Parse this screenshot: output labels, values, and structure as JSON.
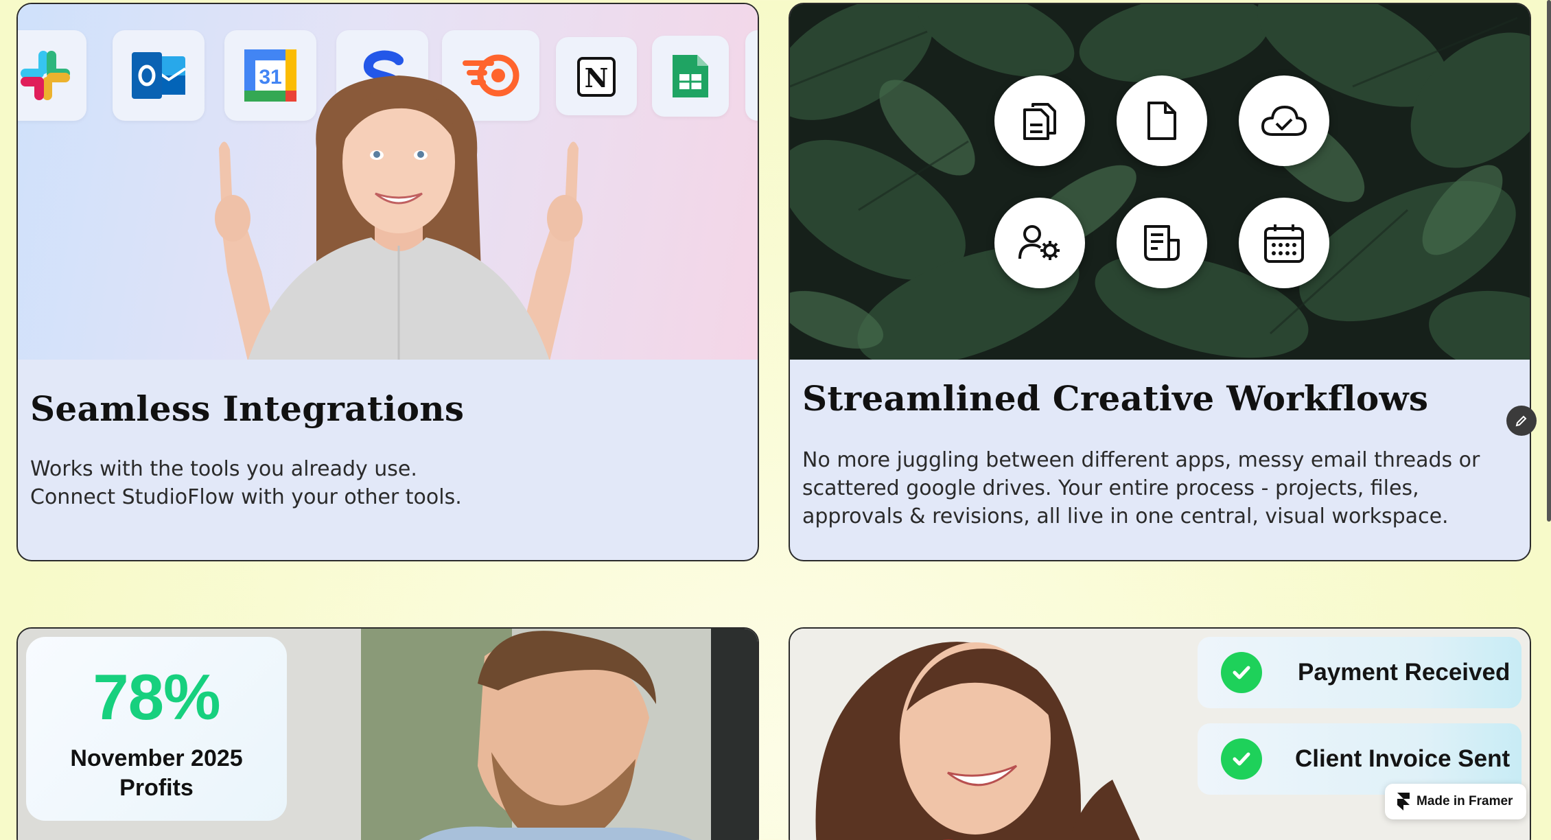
{
  "cards": {
    "integrations": {
      "title": "Seamless Integrations",
      "line1": "Works with the tools you already use.",
      "line2": "Connect StudioFlow with your other tools.",
      "apps": [
        "slack-icon",
        "outlook-icon",
        "google-calendar-icon",
        "s-app-icon",
        "semrush-icon",
        "notion-icon",
        "google-sheets-icon"
      ],
      "calendar_day": "31"
    },
    "workflows": {
      "title": "Streamlined Creative Workflows",
      "line1": "No more juggling between different apps, messy email threads or",
      "line2": "scattered google drives. Your entire process - projects, files,",
      "line3": "approvals & revisions, all live in one central, visual workspace.",
      "icons": [
        "copy-documents-icon",
        "document-icon",
        "cloud-check-icon",
        "user-settings-icon",
        "report-icon",
        "calendar-icon"
      ]
    },
    "profits": {
      "value": "78%",
      "label_line1": "November 2025",
      "label_line2": "Profits"
    },
    "payments": {
      "notif1": "Payment Received",
      "notif2": "Client Invoice Sent"
    }
  },
  "badge": {
    "label": "Made in Framer"
  },
  "colors": {
    "page_bg": "#fbfcd6",
    "card_bg": "#e2e8f8",
    "stat_green": "#17d07e",
    "check_green": "#1ed15a"
  }
}
